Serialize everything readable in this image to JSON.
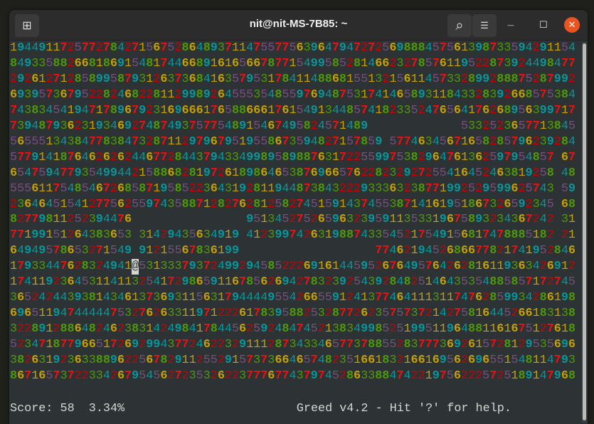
{
  "window": {
    "title": "nit@nit-MS-7B85: ~",
    "icons": {
      "new_tab": "new-tab-icon",
      "search": "search-icon",
      "menu": "hamburger-menu-icon",
      "minimize": "minimize-icon",
      "maximize": "maximize-icon",
      "close": "close-icon"
    },
    "glyphs": {
      "new_tab": "⊞",
      "search": "⌕",
      "menu": "☰",
      "minimize": "—",
      "maximize": "☐",
      "close": "✕"
    }
  },
  "colors": {
    "1": "#c4a000",
    "2": "#cc0000",
    "3": "#4e9a06",
    "4": "#06989a",
    "5": "#75507b",
    "6": "#c4a000",
    "7": "#ef1010",
    "8": "#4e9a06",
    "9": "#06989a",
    "@": "#d3d7cf"
  },
  "game": {
    "player_char": "@",
    "rows": [
      "1944911725772784271567528648937114755775639647947272569888457561398733594291154",
      "8493358826681869154817446689161656678771549958528146623278576119522873924498477",
      "2926127128589958793126373684163579531784114886815513215611457332899288875287992",
      "6939573679522824682281129989264555354855976948753174146589311843328392668575384",
      "7438345419471789679231696661765886661761549134485741823352476564176268956399717",
      "73948793623193469274874937577548915467495824571489             5332523657713845",
      "5655513438477838473287112979679519558673594827157859 57746345671658285796239284",
      "5779141876462626244677284437943349989589887631722559975382964761362597954857 67",
      "6547594779354994421588682819726189864653876966576228232927255416452463819258 48",
      "5556117548546726858719585223643192811944873843222933363238771992529599625743 59",
      "2364645154127756255974358871282762812582745159143745538714161951867326592345 68",
      "82779811252394476                9513452752659632395911353319675893234367242 31",
      "77199151264383653 31429435634919 4123997426319887433545217549156817478885182 21",
      "64949578653271549 91215567836199                   7746219452686677821741952846",
      "17933447628324941@5313337937249929458522269161445952676495764262816119363426912",
      "1741192364531141132541729865911678562694278323925439284825146435354885857172745",
      "3652424439381434613736931156317944449554266559124137746411131174762859934286198",
      "6965119474444475327626331197122261783958825328772623575737214275816445266183138",
      "3228912886482462383142498417844562592484745213834998525199511964881161675127618",
      "5234718779665172692994377246223291112873433465773788552837773692615728129535696",
      "3826319236338896225678291125529157373664657482351661832166169562696551548114793",
      "8671657372233426795456272353262237776774379745286338847422197562225725189147968"
    ]
  },
  "status": {
    "score": "Score: 58  3.34%",
    "help": "Greed v4.2 - Hit '?' for help."
  }
}
